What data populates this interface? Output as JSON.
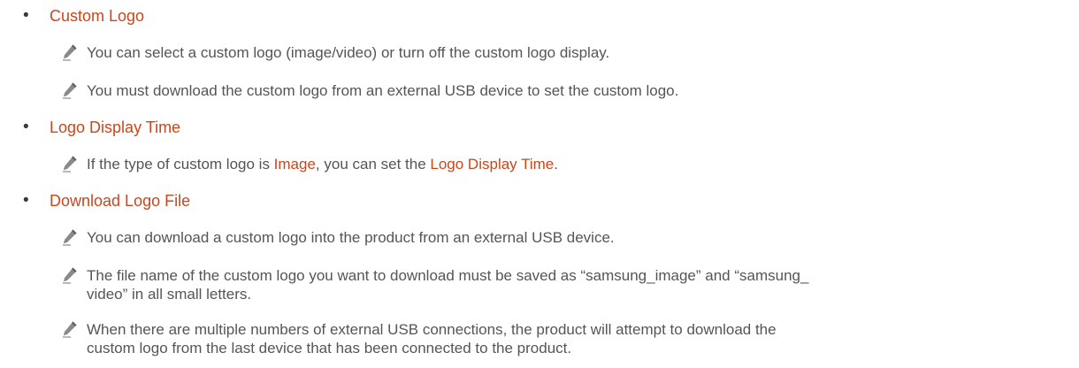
{
  "sections": [
    {
      "title": "Custom Logo",
      "notes": [
        {
          "text": "You can select a custom logo (image/video) or turn off the custom logo display."
        },
        {
          "text": "You must download the custom logo from an external USB device to set the custom logo."
        }
      ]
    },
    {
      "title": "Logo Display Time",
      "notes": [
        {
          "pre": "If the type of custom logo is ",
          "hl1": "Image",
          "mid": ", you can set the ",
          "hl2": "Logo Display Time",
          "post": "."
        }
      ]
    },
    {
      "title": "Download Logo File",
      "notes": [
        {
          "text": "You can download a custom logo into the product from an external USB device."
        },
        {
          "line1": "The file name of the custom logo you want to download must be saved as “samsung_image” and “samsung_",
          "line2": "video” in all small letters."
        },
        {
          "line1": "When there are multiple numbers of external USB connections, the product will attempt to download the",
          "line2": "custom logo from the last device that has been connected to the product."
        }
      ]
    }
  ],
  "icons": {
    "bullet": "bullet-dot",
    "note": "pencil-icon"
  },
  "colors": {
    "accent": "#c8471c",
    "body_text": "#555555",
    "icon": "#7a7a7a"
  },
  "bullet_glyph": "•"
}
